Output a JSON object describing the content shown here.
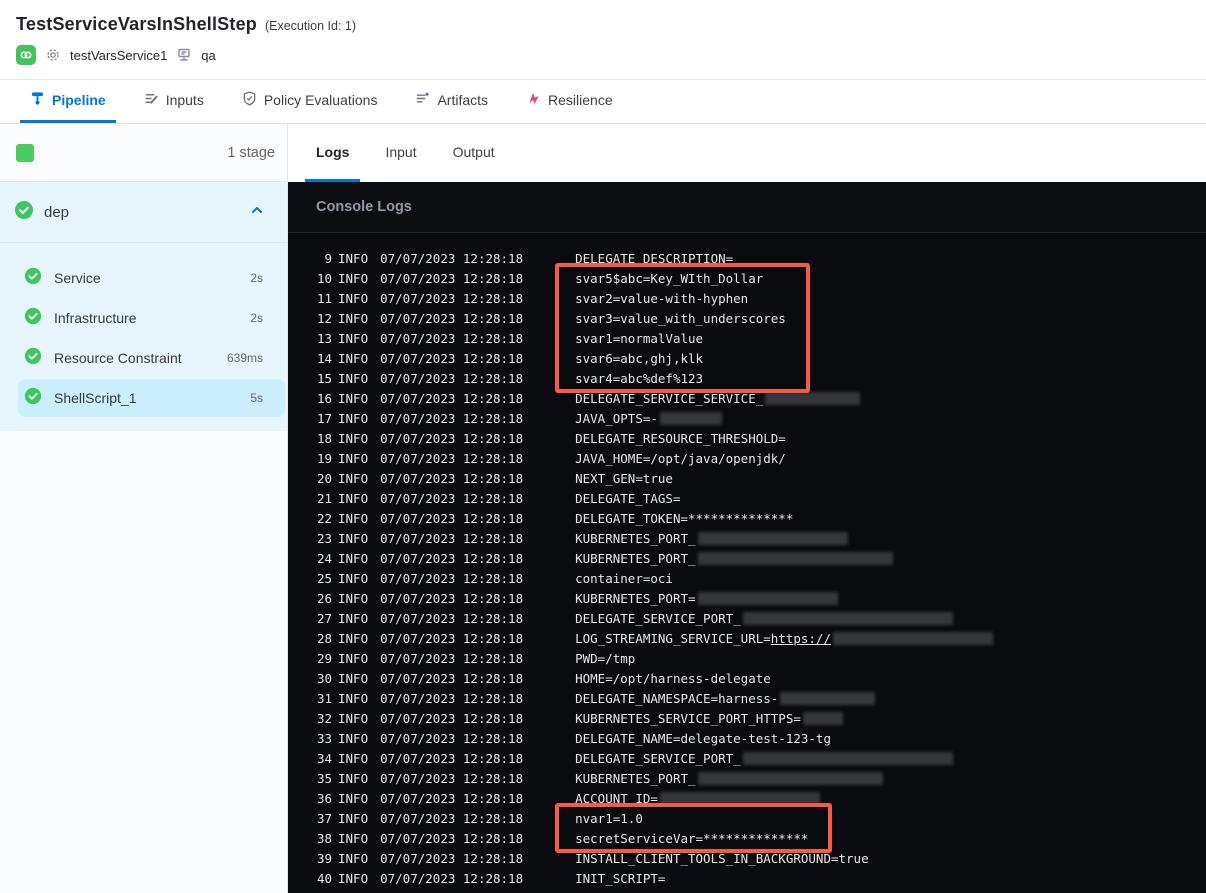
{
  "header": {
    "title": "TestServiceVarsInShellStep",
    "execution_id": "(Execution Id: 1)",
    "service_name": "testVarsService1",
    "environment_name": "qa"
  },
  "tabs": [
    {
      "label": "Pipeline",
      "icon": "pipeline-icon",
      "active": true
    },
    {
      "label": "Inputs",
      "icon": "inputs-icon",
      "active": false
    },
    {
      "label": "Policy Evaluations",
      "icon": "policy-shield-icon",
      "active": false
    },
    {
      "label": "Artifacts",
      "icon": "artifacts-icon",
      "active": false
    },
    {
      "label": "Resilience",
      "icon": "resilience-icon",
      "active": false
    }
  ],
  "sidebar": {
    "stage_count_label": "1 stage",
    "stage": {
      "name": "dep",
      "status": "success",
      "expanded": true
    },
    "steps": [
      {
        "label": "Service",
        "duration": "2s",
        "status": "success",
        "selected": false
      },
      {
        "label": "Infrastructure",
        "duration": "2s",
        "status": "success",
        "selected": false
      },
      {
        "label": "Resource Constraint",
        "duration": "639ms",
        "status": "success",
        "selected": false
      },
      {
        "label": "ShellScript_1",
        "duration": "5s",
        "status": "success",
        "selected": true
      }
    ]
  },
  "log_panel": {
    "tabs": [
      {
        "label": "Logs",
        "active": true
      },
      {
        "label": "Input",
        "active": false
      },
      {
        "label": "Output",
        "active": false
      }
    ],
    "console_title": "Console Logs",
    "level": "INFO",
    "timestamp": "07/07/2023 12:28:18",
    "lines": [
      {
        "num": 9,
        "parts": [
          {
            "text": "DELEGATE_DESCRIPTION="
          }
        ]
      },
      {
        "num": 10,
        "parts": [
          {
            "text": "svar5$abc=Key_WIth_Dollar"
          }
        ]
      },
      {
        "num": 11,
        "parts": [
          {
            "text": "svar2=value-with-hyphen"
          }
        ]
      },
      {
        "num": 12,
        "parts": [
          {
            "text": "svar3=value_with_underscores"
          }
        ]
      },
      {
        "num": 13,
        "parts": [
          {
            "text": "svar1=normalValue"
          }
        ]
      },
      {
        "num": 14,
        "parts": [
          {
            "text": "svar6=abc,ghj,klk"
          }
        ]
      },
      {
        "num": 15,
        "parts": [
          {
            "text": "svar4=abc%def%123"
          }
        ]
      },
      {
        "num": 16,
        "parts": [
          {
            "text": "DELEGATE_SERVICE_SERVICE_"
          },
          {
            "redacted": 95
          }
        ]
      },
      {
        "num": 17,
        "parts": [
          {
            "text": "JAVA_OPTS=-"
          },
          {
            "redacted": 62
          }
        ]
      },
      {
        "num": 18,
        "parts": [
          {
            "text": "DELEGATE_RESOURCE_THRESHOLD="
          }
        ]
      },
      {
        "num": 19,
        "parts": [
          {
            "text": "JAVA_HOME=/opt/java/openjdk/"
          }
        ]
      },
      {
        "num": 20,
        "parts": [
          {
            "text": "NEXT_GEN=true"
          }
        ]
      },
      {
        "num": 21,
        "parts": [
          {
            "text": "DELEGATE_TAGS="
          }
        ]
      },
      {
        "num": 22,
        "parts": [
          {
            "text": "DELEGATE_TOKEN=**************"
          }
        ]
      },
      {
        "num": 23,
        "parts": [
          {
            "text": "KUBERNETES_PORT_"
          },
          {
            "redacted": 150
          }
        ]
      },
      {
        "num": 24,
        "parts": [
          {
            "text": "KUBERNETES_PORT_"
          },
          {
            "redacted": 195
          }
        ]
      },
      {
        "num": 25,
        "parts": [
          {
            "text": "container=oci"
          }
        ]
      },
      {
        "num": 26,
        "parts": [
          {
            "text": "KUBERNETES_PORT="
          },
          {
            "redacted": 140
          }
        ]
      },
      {
        "num": 27,
        "parts": [
          {
            "text": "DELEGATE_SERVICE_PORT_"
          },
          {
            "redacted": 210
          }
        ]
      },
      {
        "num": 28,
        "parts": [
          {
            "text": "LOG_STREAMING_SERVICE_URL="
          },
          {
            "link": "https://"
          },
          {
            "redacted": 160
          }
        ]
      },
      {
        "num": 29,
        "parts": [
          {
            "text": "PWD=/tmp"
          }
        ]
      },
      {
        "num": 30,
        "parts": [
          {
            "text": "HOME=/opt/harness-delegate"
          }
        ]
      },
      {
        "num": 31,
        "parts": [
          {
            "text": "DELEGATE_NAMESPACE=harness-"
          },
          {
            "redacted": 95
          }
        ]
      },
      {
        "num": 32,
        "parts": [
          {
            "text": "KUBERNETES_SERVICE_PORT_HTTPS="
          },
          {
            "redacted": 40
          }
        ]
      },
      {
        "num": 33,
        "parts": [
          {
            "text": "DELEGATE_NAME=delegate-test-123-tg"
          }
        ]
      },
      {
        "num": 34,
        "parts": [
          {
            "text": "DELEGATE_SERVICE_PORT_"
          },
          {
            "redacted": 210
          }
        ]
      },
      {
        "num": 35,
        "parts": [
          {
            "text": "KUBERNETES_PORT_"
          },
          {
            "redacted": 185
          }
        ]
      },
      {
        "num": 36,
        "parts": [
          {
            "text": "ACCOUNT_ID="
          },
          {
            "redacted": 160
          }
        ]
      },
      {
        "num": 37,
        "parts": [
          {
            "text": "nvar1=1.0"
          }
        ]
      },
      {
        "num": 38,
        "parts": [
          {
            "text": "secretServiceVar=**************"
          }
        ]
      },
      {
        "num": 39,
        "parts": [
          {
            "text": "INSTALL_CLIENT_TOOLS_IN_BACKGROUND=true"
          }
        ]
      },
      {
        "num": 40,
        "parts": [
          {
            "text": "INIT_SCRIPT="
          }
        ]
      }
    ],
    "highlight_boxes": [
      {
        "from_line": 10,
        "to_line": 15
      },
      {
        "from_line": 37,
        "to_line": 38
      }
    ]
  },
  "colors": {
    "accent_blue": "#0278d5",
    "success_green": "#42c45a",
    "highlight_red": "#f45c48",
    "resilience_pink": "#e0457d",
    "stage_bg_blue": "#e7f6fd",
    "selected_step_blue": "#cbeffc",
    "console_bg": "#0a0b0e"
  }
}
